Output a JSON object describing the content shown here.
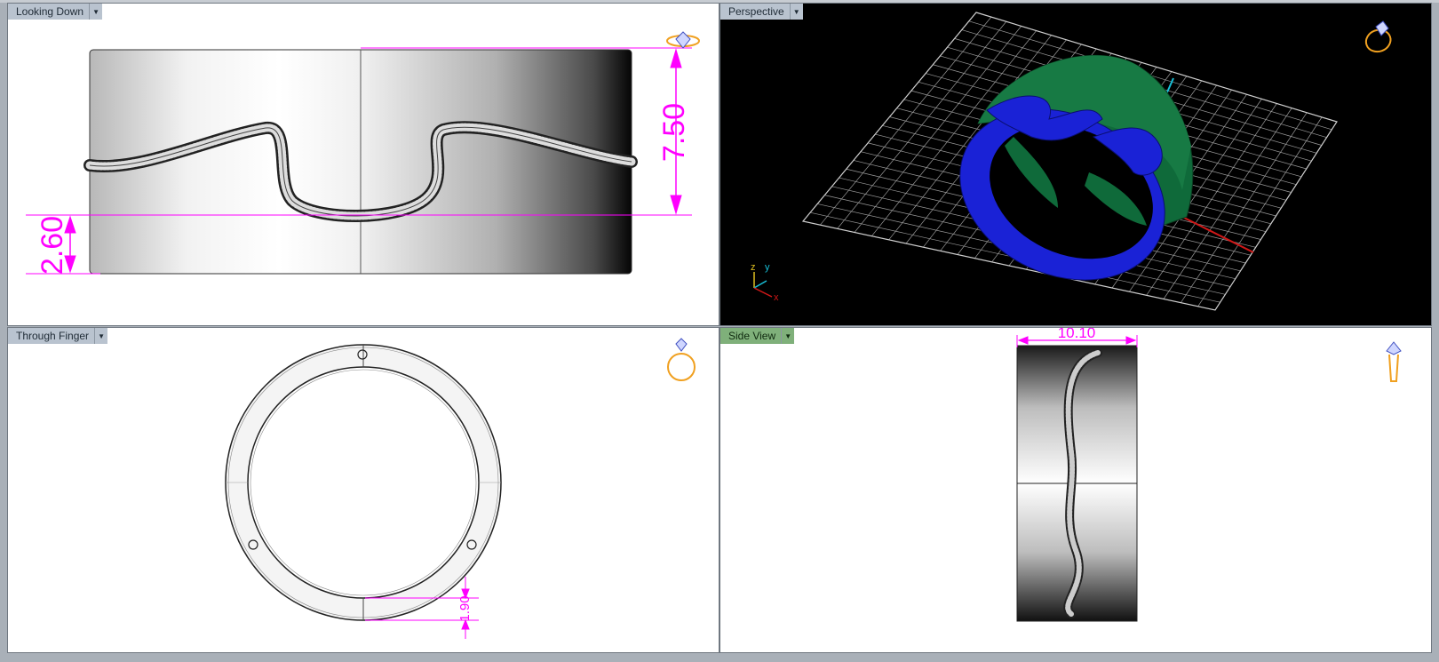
{
  "viewports": [
    {
      "name": "Looking Down",
      "active": false,
      "dimensions": [
        "7.50",
        "2.60"
      ]
    },
    {
      "name": "Perspective",
      "active": false,
      "axes": [
        "z",
        "y",
        "x"
      ]
    },
    {
      "name": "Through Finger",
      "active": false,
      "dimensions": [
        "1.90"
      ]
    },
    {
      "name": "Side View",
      "active": true,
      "dimensions": [
        "10.10"
      ]
    }
  ],
  "colors": {
    "dimension": "#ff00ff",
    "ring_blue": "#1a22d6",
    "ring_green": "#0f6a3a",
    "grid": "#9a9a9a",
    "active_tab": "#7fb07a",
    "icon_gold": "#f0a020"
  },
  "icons": [
    "ring-view-icon-top",
    "ring-view-icon-perspective",
    "ring-view-icon-front",
    "ring-view-icon-side"
  ]
}
